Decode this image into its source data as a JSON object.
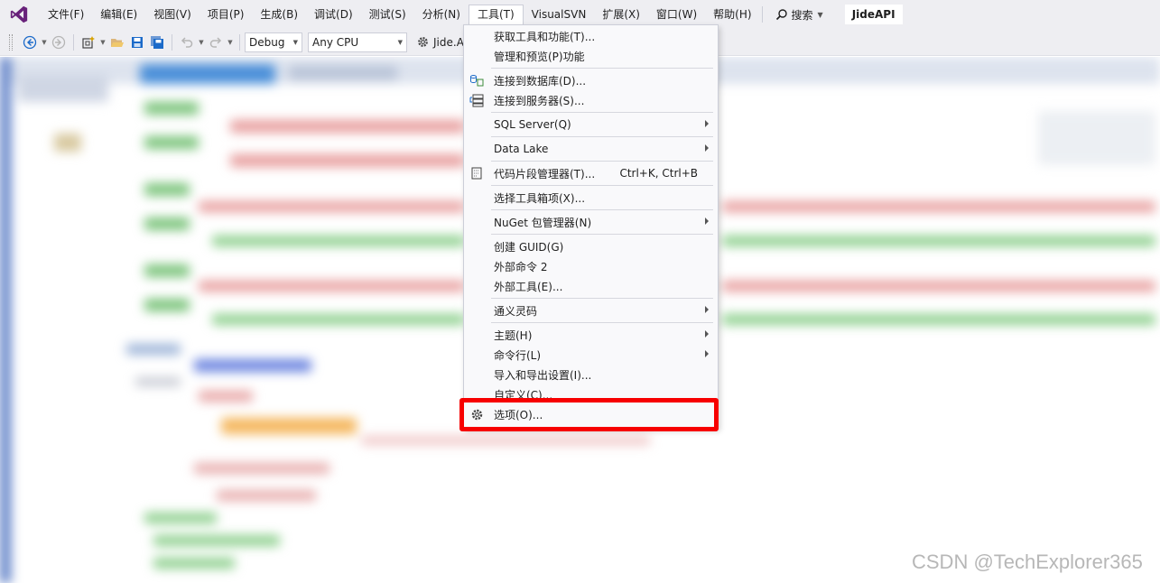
{
  "menubar": {
    "items": [
      "文件(F)",
      "编辑(E)",
      "视图(V)",
      "项目(P)",
      "生成(B)",
      "调试(D)",
      "测试(S)",
      "分析(N)",
      "工具(T)",
      "VisualSVN",
      "扩展(X)",
      "窗口(W)",
      "帮助(H)"
    ],
    "active_item": "工具(T)",
    "search_label": "搜索",
    "solution_name": "JideAPI"
  },
  "toolbar": {
    "config_value": "Debug",
    "platform_value": "Any CPU",
    "startup_project": "Jide.A"
  },
  "tools_menu": {
    "items": [
      {
        "label": "获取工具和功能(T)...",
        "icon": "",
        "submenu": false
      },
      {
        "label": "管理和预览(P)功能",
        "icon": "",
        "submenu": false
      },
      {
        "label": "连接到数据库(D)...",
        "icon": "connect-database-icon",
        "submenu": false
      },
      {
        "label": "连接到服务器(S)...",
        "icon": "connect-server-icon",
        "submenu": false
      },
      {
        "label": "SQL Server(Q)",
        "icon": "",
        "submenu": true
      },
      {
        "label": "Data Lake",
        "icon": "",
        "submenu": true
      },
      {
        "label": "代码片段管理器(T)...",
        "icon": "snippet-manager-icon",
        "shortcut": "Ctrl+K, Ctrl+B",
        "submenu": false
      },
      {
        "label": "选择工具箱项(X)...",
        "icon": "",
        "submenu": false
      },
      {
        "label": "NuGet 包管理器(N)",
        "icon": "",
        "submenu": true
      },
      {
        "label": "创建 GUID(G)",
        "icon": "",
        "submenu": false
      },
      {
        "label": "外部命令 2",
        "icon": "",
        "submenu": false
      },
      {
        "label": "外部工具(E)...",
        "icon": "",
        "submenu": false
      },
      {
        "label": "通义灵码",
        "icon": "",
        "submenu": true
      },
      {
        "label": "主题(H)",
        "icon": "",
        "submenu": true
      },
      {
        "label": "命令行(L)",
        "icon": "",
        "submenu": true
      },
      {
        "label": "导入和导出设置(I)...",
        "icon": "",
        "submenu": false
      },
      {
        "label": "自定义(C)...",
        "icon": "",
        "submenu": false
      },
      {
        "label": "选项(O)...",
        "icon": "gear-icon",
        "submenu": false,
        "highlighted": true
      }
    ]
  },
  "watermark": "CSDN @TechExplorer365",
  "colors": {
    "menubar_bg": "#eeeef2",
    "menu_bg": "#f9f9fb",
    "highlight_border": "#f70000",
    "vs_logo": "#68217a"
  }
}
